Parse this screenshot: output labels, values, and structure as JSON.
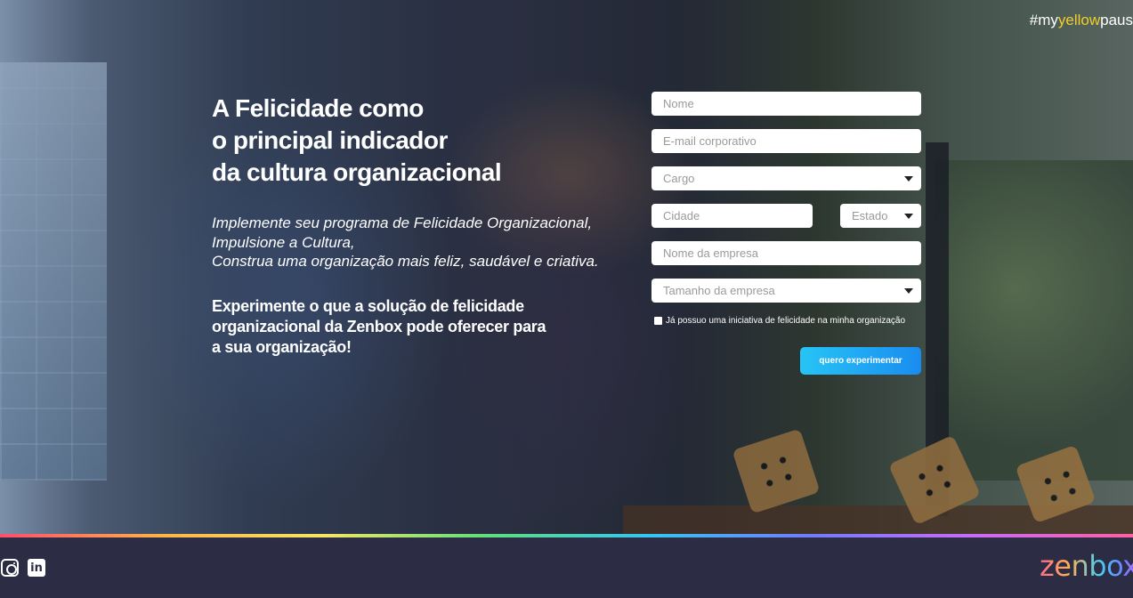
{
  "hashtag": {
    "prefix": "#my",
    "highlight": "yellow",
    "suffix": "paus"
  },
  "hero": {
    "headline": [
      "A Felicidade como",
      "o principal indicador",
      "da cultura organizacional"
    ],
    "subheadline": [
      "Implemente seu programa de Felicidade Organizacional,",
      "Impulsione a Cultura,",
      "Construa uma organização mais feliz, saudável e criativa."
    ],
    "cta_text": "Experimente o que a solução de felicidade organizacional da Zenbox pode oferecer para a sua organização!"
  },
  "form": {
    "name_placeholder": "Nome",
    "email_placeholder": "E-mail corporativo",
    "cargo_selected": "Cargo",
    "city_placeholder": "Cidade",
    "state_selected": "Estado",
    "company_placeholder": "Nome da empresa",
    "company_size_selected": "Tamanho da empresa",
    "checkbox_label": "Já possuo uma iniciativa de felicidade na minha organização",
    "submit_label": "quero experimentar"
  },
  "footer": {
    "icons": [
      "instagram-icon",
      "linkedin-icon"
    ],
    "linkedin_glyph": "in",
    "logo": "zenbox"
  },
  "colors": {
    "hashtag_accent": "#f2cf2a",
    "button": "#1a8cf0",
    "footer_bg": "#2c2c44"
  }
}
